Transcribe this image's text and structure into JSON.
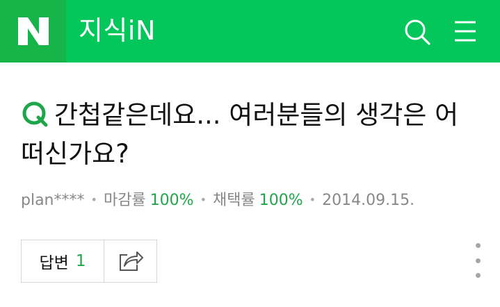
{
  "header": {
    "logo_letter": "N",
    "service_title": "지식iN",
    "icons": [
      "search-icon",
      "menu-icon"
    ],
    "colors": {
      "brand": "#03c75a",
      "logo_bg": "#16b449"
    }
  },
  "question": {
    "title": "간첩같은데요... 여러분들의 생각은 어떠신가요?",
    "mark_icon": "q-icon"
  },
  "meta": {
    "author": "plan****",
    "close_rate_label": "마감률",
    "close_rate_value": "100%",
    "adopt_rate_label": "채택률",
    "adopt_rate_value": "100%",
    "date": "2014.09.15.",
    "accent_color": "#1fa64a"
  },
  "actions": {
    "answer_label": "답변",
    "answer_count": "1",
    "share_icon": "share-icon",
    "more_icon": "more-vertical-icon"
  }
}
